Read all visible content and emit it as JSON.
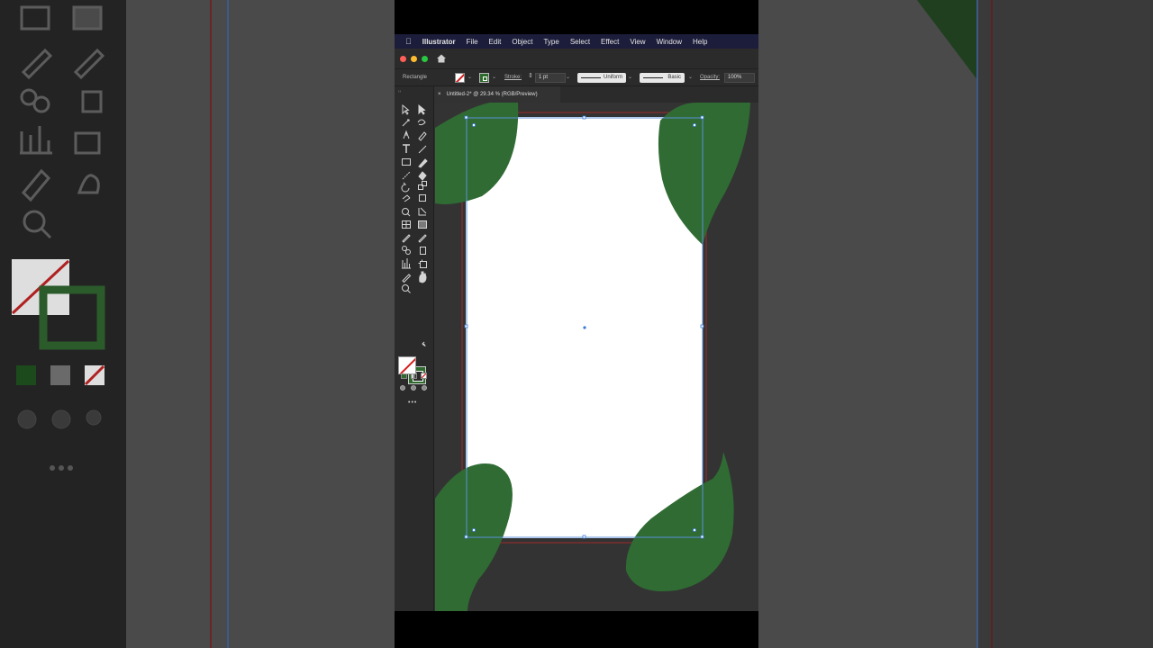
{
  "menubar": {
    "app_name": "Illustrator",
    "items": [
      "File",
      "Edit",
      "Object",
      "Type",
      "Select",
      "Effect",
      "View",
      "Window",
      "Help"
    ]
  },
  "controlbar": {
    "selection_label": "Rectangle",
    "stroke_label": "Stroke:",
    "stroke_weight": "1 pt",
    "profile_label": "Uniform",
    "brush_label": "Basic",
    "opacity_label": "Opacity:",
    "opacity_value": "100%"
  },
  "document": {
    "tab_title": "Untitled-2* @ 29.34 % (RGB/Preview)"
  },
  "colors": {
    "leaf_green": "#2f6b33",
    "accent_blue": "#3a7bd5",
    "artboard_bleed_red": "#b02a2a",
    "menubar_bg": "#1c1d3a"
  },
  "toolbar": {
    "more_tools_label": "•••"
  }
}
